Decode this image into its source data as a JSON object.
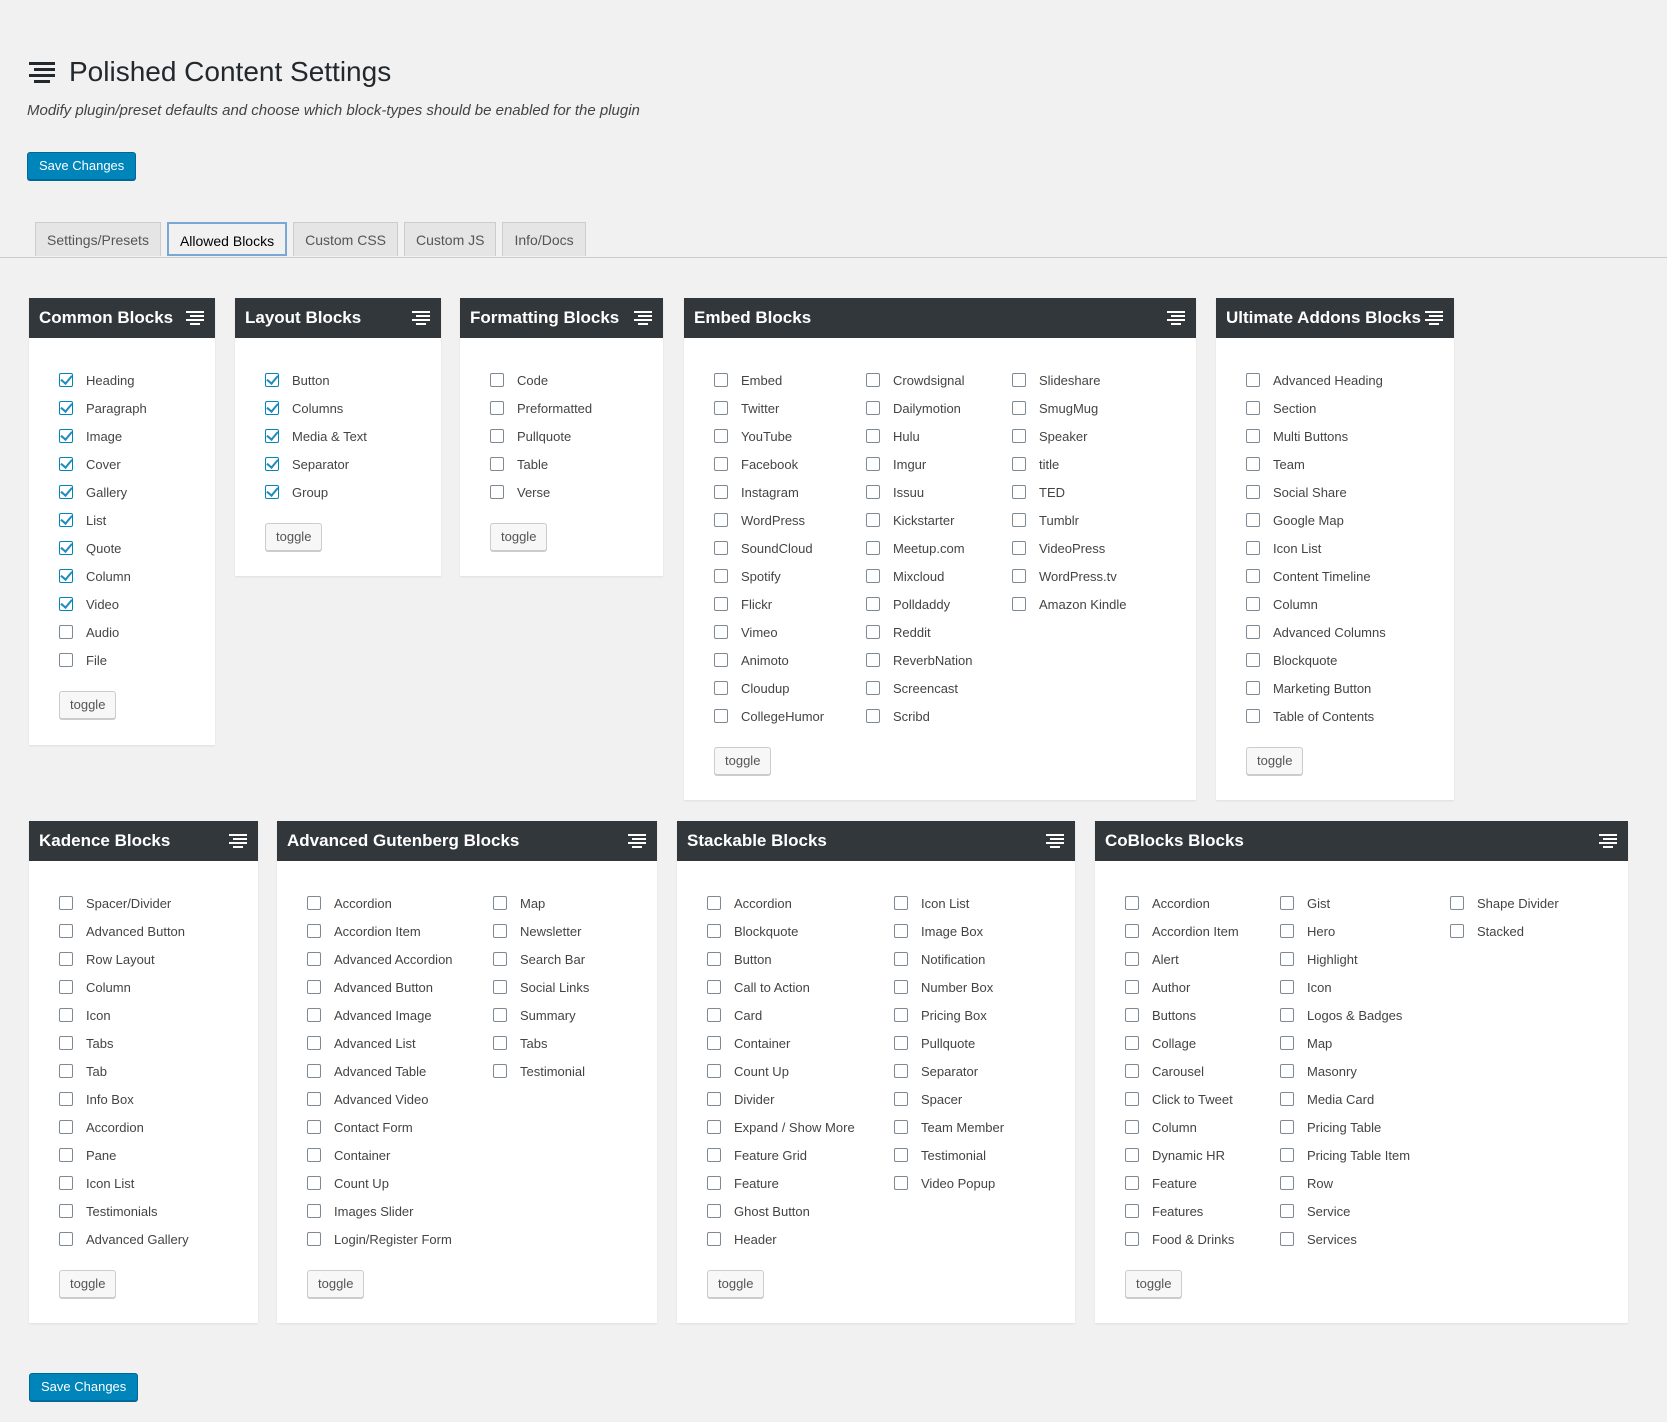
{
  "header": {
    "title": "Polished Content Settings",
    "subtitle": "Modify plugin/preset defaults and choose which block-types should be enabled for the plugin",
    "icon": "settings-list-icon"
  },
  "save_label": "Save Changes",
  "tabs": [
    {
      "label": "Settings/Presets",
      "active": false
    },
    {
      "label": "Allowed Blocks",
      "active": true
    },
    {
      "label": "Custom CSS",
      "active": false
    },
    {
      "label": "Custom JS",
      "active": false
    },
    {
      "label": "Info/Docs",
      "active": false
    }
  ],
  "toggle_label": "toggle",
  "colors": {
    "accent": "#0085ba",
    "panel_header": "#32373c"
  },
  "panels": [
    {
      "title": "Common Blocks",
      "columns": [
        [
          {
            "label": "Heading",
            "checked": true
          },
          {
            "label": "Paragraph",
            "checked": true
          },
          {
            "label": "Image",
            "checked": true
          },
          {
            "label": "Cover",
            "checked": true
          },
          {
            "label": "Gallery",
            "checked": true
          },
          {
            "label": "List",
            "checked": true
          },
          {
            "label": "Quote",
            "checked": true
          },
          {
            "label": "Column",
            "checked": true
          },
          {
            "label": "Video",
            "checked": true
          },
          {
            "label": "Audio",
            "checked": false
          },
          {
            "label": "File",
            "checked": false
          }
        ]
      ]
    },
    {
      "title": "Layout Blocks",
      "columns": [
        [
          {
            "label": "Button",
            "checked": true
          },
          {
            "label": "Columns",
            "checked": true
          },
          {
            "label": "Media & Text",
            "checked": true
          },
          {
            "label": "Separator",
            "checked": true
          },
          {
            "label": "Group",
            "checked": true
          }
        ]
      ]
    },
    {
      "title": "Formatting Blocks",
      "columns": [
        [
          {
            "label": "Code",
            "checked": false
          },
          {
            "label": "Preformatted",
            "checked": false
          },
          {
            "label": "Pullquote",
            "checked": false
          },
          {
            "label": "Table",
            "checked": false
          },
          {
            "label": "Verse",
            "checked": false
          }
        ]
      ]
    },
    {
      "title": "Embed Blocks",
      "columns": [
        [
          {
            "label": "Embed",
            "checked": false
          },
          {
            "label": "Twitter",
            "checked": false
          },
          {
            "label": "YouTube",
            "checked": false
          },
          {
            "label": "Facebook",
            "checked": false
          },
          {
            "label": "Instagram",
            "checked": false
          },
          {
            "label": "WordPress",
            "checked": false
          },
          {
            "label": "SoundCloud",
            "checked": false
          },
          {
            "label": "Spotify",
            "checked": false
          },
          {
            "label": "Flickr",
            "checked": false
          },
          {
            "label": "Vimeo",
            "checked": false
          },
          {
            "label": "Animoto",
            "checked": false
          },
          {
            "label": "Cloudup",
            "checked": false
          },
          {
            "label": "CollegeHumor",
            "checked": false
          }
        ],
        [
          {
            "label": "Crowdsignal",
            "checked": false
          },
          {
            "label": "Dailymotion",
            "checked": false
          },
          {
            "label": "Hulu",
            "checked": false
          },
          {
            "label": "Imgur",
            "checked": false
          },
          {
            "label": "Issuu",
            "checked": false
          },
          {
            "label": "Kickstarter",
            "checked": false
          },
          {
            "label": "Meetup.com",
            "checked": false
          },
          {
            "label": "Mixcloud",
            "checked": false
          },
          {
            "label": "Polldaddy",
            "checked": false
          },
          {
            "label": "Reddit",
            "checked": false
          },
          {
            "label": "ReverbNation",
            "checked": false
          },
          {
            "label": "Screencast",
            "checked": false
          },
          {
            "label": "Scribd",
            "checked": false
          }
        ],
        [
          {
            "label": "Slideshare",
            "checked": false
          },
          {
            "label": "SmugMug",
            "checked": false
          },
          {
            "label": "Speaker",
            "checked": false
          },
          {
            "label": "title",
            "checked": false
          },
          {
            "label": "TED",
            "checked": false
          },
          {
            "label": "Tumblr",
            "checked": false
          },
          {
            "label": "VideoPress",
            "checked": false
          },
          {
            "label": "WordPress.tv",
            "checked": false
          },
          {
            "label": "Amazon Kindle",
            "checked": false
          }
        ]
      ]
    },
    {
      "title": "Ultimate Addons Blocks",
      "columns": [
        [
          {
            "label": "Advanced Heading",
            "checked": false
          },
          {
            "label": "Section",
            "checked": false
          },
          {
            "label": "Multi Buttons",
            "checked": false
          },
          {
            "label": "Team",
            "checked": false
          },
          {
            "label": "Social Share",
            "checked": false
          },
          {
            "label": "Google Map",
            "checked": false
          },
          {
            "label": "Icon List",
            "checked": false
          },
          {
            "label": "Content Timeline",
            "checked": false
          },
          {
            "label": "Column",
            "checked": false
          },
          {
            "label": "Advanced Columns",
            "checked": false
          },
          {
            "label": "Blockquote",
            "checked": false
          },
          {
            "label": "Marketing Button",
            "checked": false
          },
          {
            "label": "Table of Contents",
            "checked": false
          }
        ]
      ]
    },
    {
      "title": "Kadence Blocks",
      "columns": [
        [
          {
            "label": "Spacer/Divider",
            "checked": false
          },
          {
            "label": "Advanced Button",
            "checked": false
          },
          {
            "label": "Row Layout",
            "checked": false
          },
          {
            "label": "Column",
            "checked": false
          },
          {
            "label": "Icon",
            "checked": false
          },
          {
            "label": "Tabs",
            "checked": false
          },
          {
            "label": "Tab",
            "checked": false
          },
          {
            "label": "Info Box",
            "checked": false
          },
          {
            "label": "Accordion",
            "checked": false
          },
          {
            "label": "Pane",
            "checked": false
          },
          {
            "label": "Icon List",
            "checked": false
          },
          {
            "label": "Testimonials",
            "checked": false
          },
          {
            "label": "Advanced Gallery",
            "checked": false
          }
        ]
      ]
    },
    {
      "title": "Advanced Gutenberg Blocks",
      "columns": [
        [
          {
            "label": "Accordion",
            "checked": false
          },
          {
            "label": "Accordion Item",
            "checked": false
          },
          {
            "label": "Advanced Accordion",
            "checked": false
          },
          {
            "label": "Advanced Button",
            "checked": false
          },
          {
            "label": "Advanced Image",
            "checked": false
          },
          {
            "label": "Advanced List",
            "checked": false
          },
          {
            "label": "Advanced Table",
            "checked": false
          },
          {
            "label": "Advanced Video",
            "checked": false
          },
          {
            "label": "Contact Form",
            "checked": false
          },
          {
            "label": "Container",
            "checked": false
          },
          {
            "label": "Count Up",
            "checked": false
          },
          {
            "label": "Images Slider",
            "checked": false
          },
          {
            "label": "Login/Register Form",
            "checked": false
          }
        ],
        [
          {
            "label": "Map",
            "checked": false
          },
          {
            "label": "Newsletter",
            "checked": false
          },
          {
            "label": "Search Bar",
            "checked": false
          },
          {
            "label": "Social Links",
            "checked": false
          },
          {
            "label": "Summary",
            "checked": false
          },
          {
            "label": "Tabs",
            "checked": false
          },
          {
            "label": "Testimonial",
            "checked": false
          }
        ]
      ]
    },
    {
      "title": "Stackable Blocks",
      "columns": [
        [
          {
            "label": "Accordion",
            "checked": false
          },
          {
            "label": "Blockquote",
            "checked": false
          },
          {
            "label": "Button",
            "checked": false
          },
          {
            "label": "Call to Action",
            "checked": false
          },
          {
            "label": "Card",
            "checked": false
          },
          {
            "label": "Container",
            "checked": false
          },
          {
            "label": "Count Up",
            "checked": false
          },
          {
            "label": "Divider",
            "checked": false
          },
          {
            "label": "Expand / Show More",
            "checked": false
          },
          {
            "label": "Feature Grid",
            "checked": false
          },
          {
            "label": "Feature",
            "checked": false
          },
          {
            "label": "Ghost Button",
            "checked": false
          },
          {
            "label": "Header",
            "checked": false
          }
        ],
        [
          {
            "label": "Icon List",
            "checked": false
          },
          {
            "label": "Image Box",
            "checked": false
          },
          {
            "label": "Notification",
            "checked": false
          },
          {
            "label": "Number Box",
            "checked": false
          },
          {
            "label": "Pricing Box",
            "checked": false
          },
          {
            "label": "Pullquote",
            "checked": false
          },
          {
            "label": "Separator",
            "checked": false
          },
          {
            "label": "Spacer",
            "checked": false
          },
          {
            "label": "Team Member",
            "checked": false
          },
          {
            "label": "Testimonial",
            "checked": false
          },
          {
            "label": "Video Popup",
            "checked": false
          }
        ]
      ]
    },
    {
      "title": "CoBlocks Blocks",
      "columns": [
        [
          {
            "label": "Accordion",
            "checked": false
          },
          {
            "label": "Accordion Item",
            "checked": false
          },
          {
            "label": "Alert",
            "checked": false
          },
          {
            "label": "Author",
            "checked": false
          },
          {
            "label": "Buttons",
            "checked": false
          },
          {
            "label": "Collage",
            "checked": false
          },
          {
            "label": "Carousel",
            "checked": false
          },
          {
            "label": "Click to Tweet",
            "checked": false
          },
          {
            "label": "Column",
            "checked": false
          },
          {
            "label": "Dynamic HR",
            "checked": false
          },
          {
            "label": "Feature",
            "checked": false
          },
          {
            "label": "Features",
            "checked": false
          },
          {
            "label": "Food & Drinks",
            "checked": false
          }
        ],
        [
          {
            "label": "Gist",
            "checked": false
          },
          {
            "label": "Hero",
            "checked": false
          },
          {
            "label": "Highlight",
            "checked": false
          },
          {
            "label": "Icon",
            "checked": false
          },
          {
            "label": "Logos & Badges",
            "checked": false
          },
          {
            "label": "Map",
            "checked": false
          },
          {
            "label": "Masonry",
            "checked": false
          },
          {
            "label": "Media Card",
            "checked": false
          },
          {
            "label": "Pricing Table",
            "checked": false
          },
          {
            "label": "Pricing Table Item",
            "checked": false
          },
          {
            "label": "Row",
            "checked": false
          },
          {
            "label": "Service",
            "checked": false
          },
          {
            "label": "Services",
            "checked": false
          }
        ],
        [
          {
            "label": "Shape Divider",
            "checked": false
          },
          {
            "label": "Stacked",
            "checked": false
          }
        ]
      ]
    }
  ]
}
